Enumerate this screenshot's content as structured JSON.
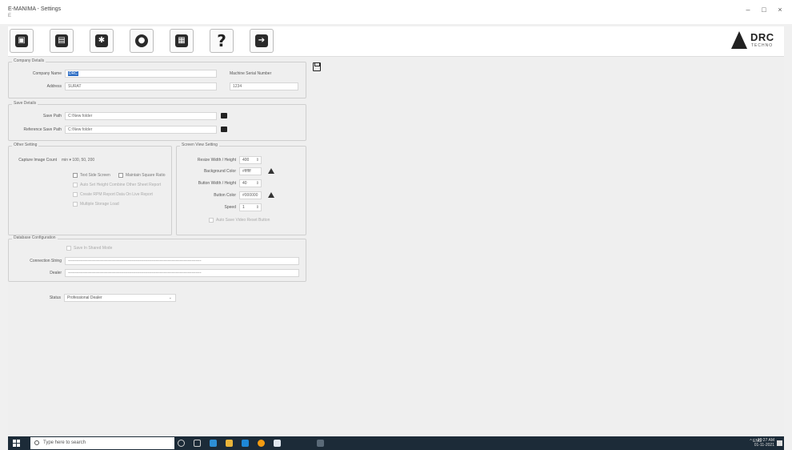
{
  "window": {
    "title": "E-MANIMA - Settings",
    "subtitle": "E",
    "controls": [
      "–",
      "□",
      "×"
    ]
  },
  "toolbar": {
    "buttons": [
      {
        "name": "camera-icon",
        "glyph": "▣"
      },
      {
        "name": "film-icon",
        "glyph": "▤"
      },
      {
        "name": "gear-icon",
        "glyph": "✱"
      },
      {
        "name": "user-icon",
        "glyph": "●"
      },
      {
        "name": "clipboard-icon",
        "glyph": "▦"
      },
      {
        "name": "help-icon",
        "glyph": "?"
      },
      {
        "name": "exit-icon",
        "glyph": "➔"
      }
    ],
    "logo_text": "DRC",
    "logo_sub": "TECHNO"
  },
  "company": {
    "legend": "Company Details",
    "name_label": "Company Name",
    "name_value": "DRC",
    "address_label": "Address",
    "address_value": "SURAT",
    "machine_label": "Machine Serial Number",
    "machine_value": "1234"
  },
  "save": {
    "legend": "Save Details",
    "path_label": "Save Path",
    "path_value": "C:\\New folder",
    "ref_label": "Reference Save Path",
    "ref_value": "C:\\New folder"
  },
  "other": {
    "legend": "Other Setting",
    "capture_label": "Capture Image Count",
    "capture_value": "min ▾  100, 50, 200",
    "chk1": "Text Side Screen",
    "chk2": "Maintain Square Ratio",
    "chk3": "Auto Set Height Combine Other Sheet Report",
    "chk4": "Create RPM Report Data On Live Report",
    "chk5": "Multiple Storage Load"
  },
  "screen": {
    "legend": "Screen View Setting",
    "rwh_label": "Resize Width / Height",
    "rwh_value": "400",
    "bg_label": "Background Color",
    "bg_value": "#ffffff",
    "bwh_label": "Button Width / Height",
    "bwh_value": "40",
    "btn_label": "Button Color",
    "btn_value": "#000000",
    "speed_label": "Speed",
    "speed_value": "1",
    "autosave": "Auto Save Video Reset Button"
  },
  "db": {
    "legend": "Database Configuration",
    "chk": "Save In Shared Mode",
    "conn_label": "Connection String",
    "conn_value": "----------------------------------------------------------------------------------------------------",
    "dept_label": "Dealer",
    "dept_value": "----------------------------------------------------------------------------------------------------"
  },
  "status": {
    "label": "Status",
    "value": "Professional Dealer"
  },
  "taskbar": {
    "search": "Type here to search",
    "tray": "^  ENG",
    "time": "10:27 AM",
    "date": "01-11-2021"
  }
}
